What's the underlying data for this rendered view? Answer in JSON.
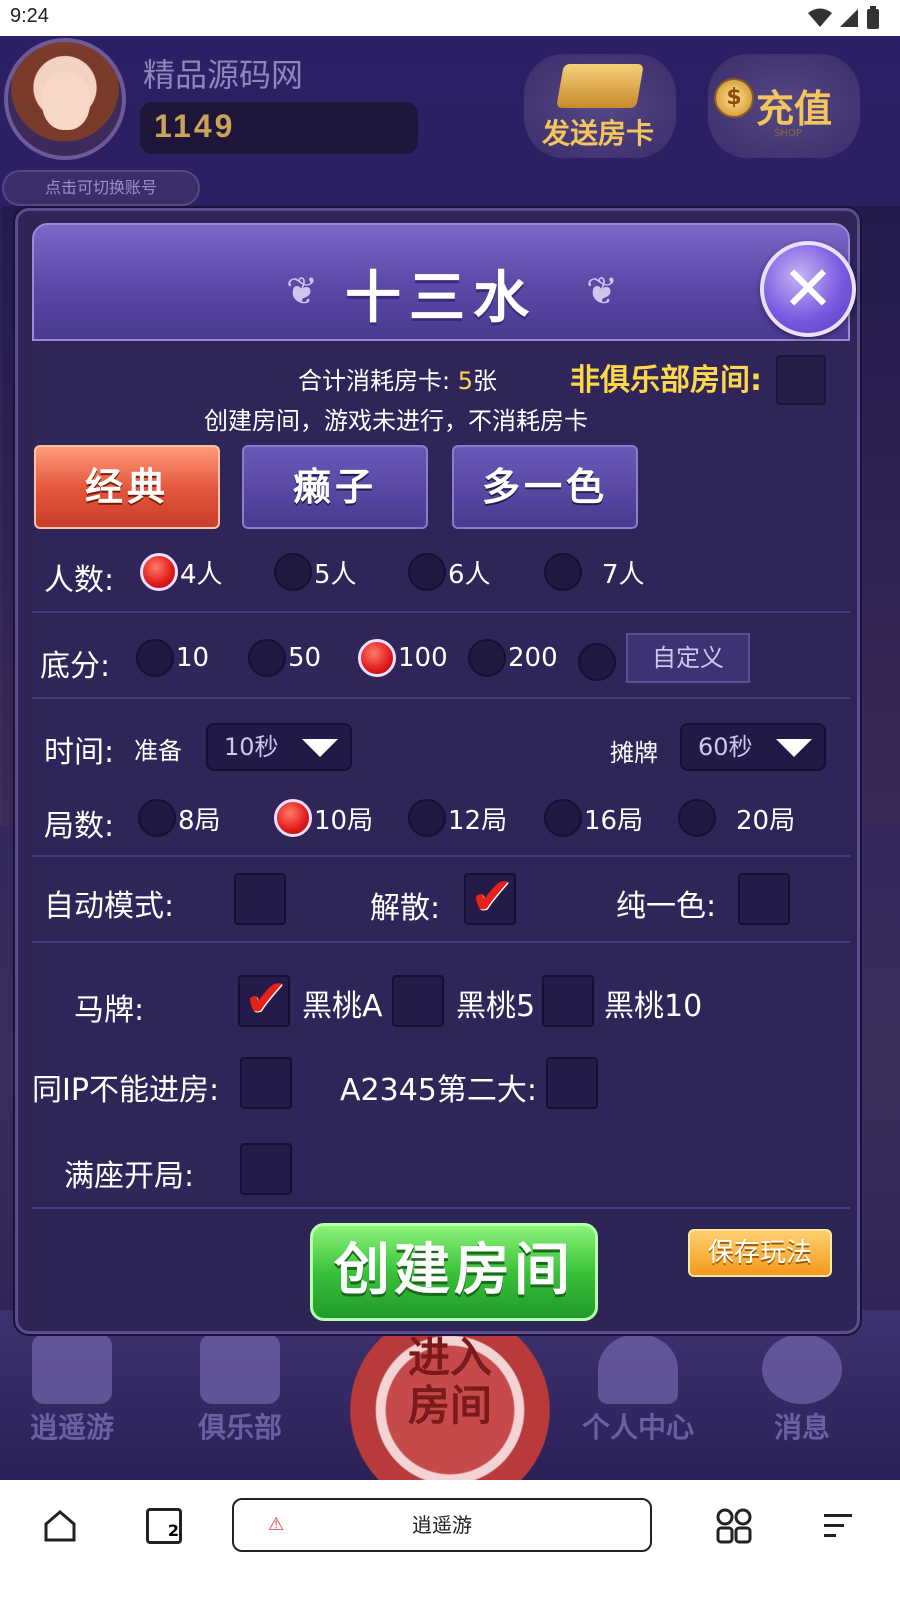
{
  "status_bar": {
    "time": "9:24"
  },
  "profile": {
    "username": "精品源码网",
    "coins": "1149",
    "switch_account": "点击可切换账号"
  },
  "top_buttons": {
    "send_card": "发送房卡",
    "recharge": "充值",
    "recharge_sub": "SHOP"
  },
  "dialog": {
    "title": "十三水",
    "cost_label": "合计消耗房卡:",
    "cost_value": "5",
    "cost_unit": "张",
    "non_club_label": "非俱乐部房间:",
    "notice": "创建房间，游戏未进行，不消耗房卡",
    "tabs": [
      {
        "label": "经典",
        "active": true
      },
      {
        "label": "癞子",
        "active": false
      },
      {
        "label": "多一色",
        "active": false
      }
    ],
    "players": {
      "label": "人数:",
      "options": [
        "4人",
        "5人",
        "6人",
        "7人"
      ],
      "selected": "4人"
    },
    "base_score": {
      "label": "底分:",
      "options": [
        "10",
        "50",
        "100",
        "200"
      ],
      "selected": "100",
      "custom_label": "自定义"
    },
    "time": {
      "label": "时间:",
      "ready_label": "准备",
      "ready_value": "10秒",
      "deal_label": "摊牌",
      "deal_value": "60秒"
    },
    "rounds": {
      "label": "局数:",
      "options": [
        "8局",
        "10局",
        "12局",
        "16局",
        "20局"
      ],
      "selected": "10局"
    },
    "toggles": {
      "auto_mode": "自动模式:",
      "dismiss": "解散:",
      "pure_color": "纯一色:"
    },
    "horse": {
      "label": "马牌:",
      "options": [
        "黑桃A",
        "黑桃5",
        "黑桃10"
      ]
    },
    "same_ip": "同IP不能进房:",
    "a2345": "A2345第二大:",
    "full_start": "满座开局:",
    "create_button": "创建房间",
    "save_button": "保存玩法"
  },
  "bottom_nav": {
    "items": [
      "逍遥游",
      "俱乐部",
      "个人中心",
      "消息"
    ],
    "center": "进入房间"
  },
  "browser": {
    "url_title": "逍遥游",
    "tab_count": "2"
  },
  "colors": {
    "accent_yellow": "#ffd84a",
    "tab_active": "#e2543a",
    "create_green": "#3ac23a",
    "save_orange": "#f39a1a"
  }
}
